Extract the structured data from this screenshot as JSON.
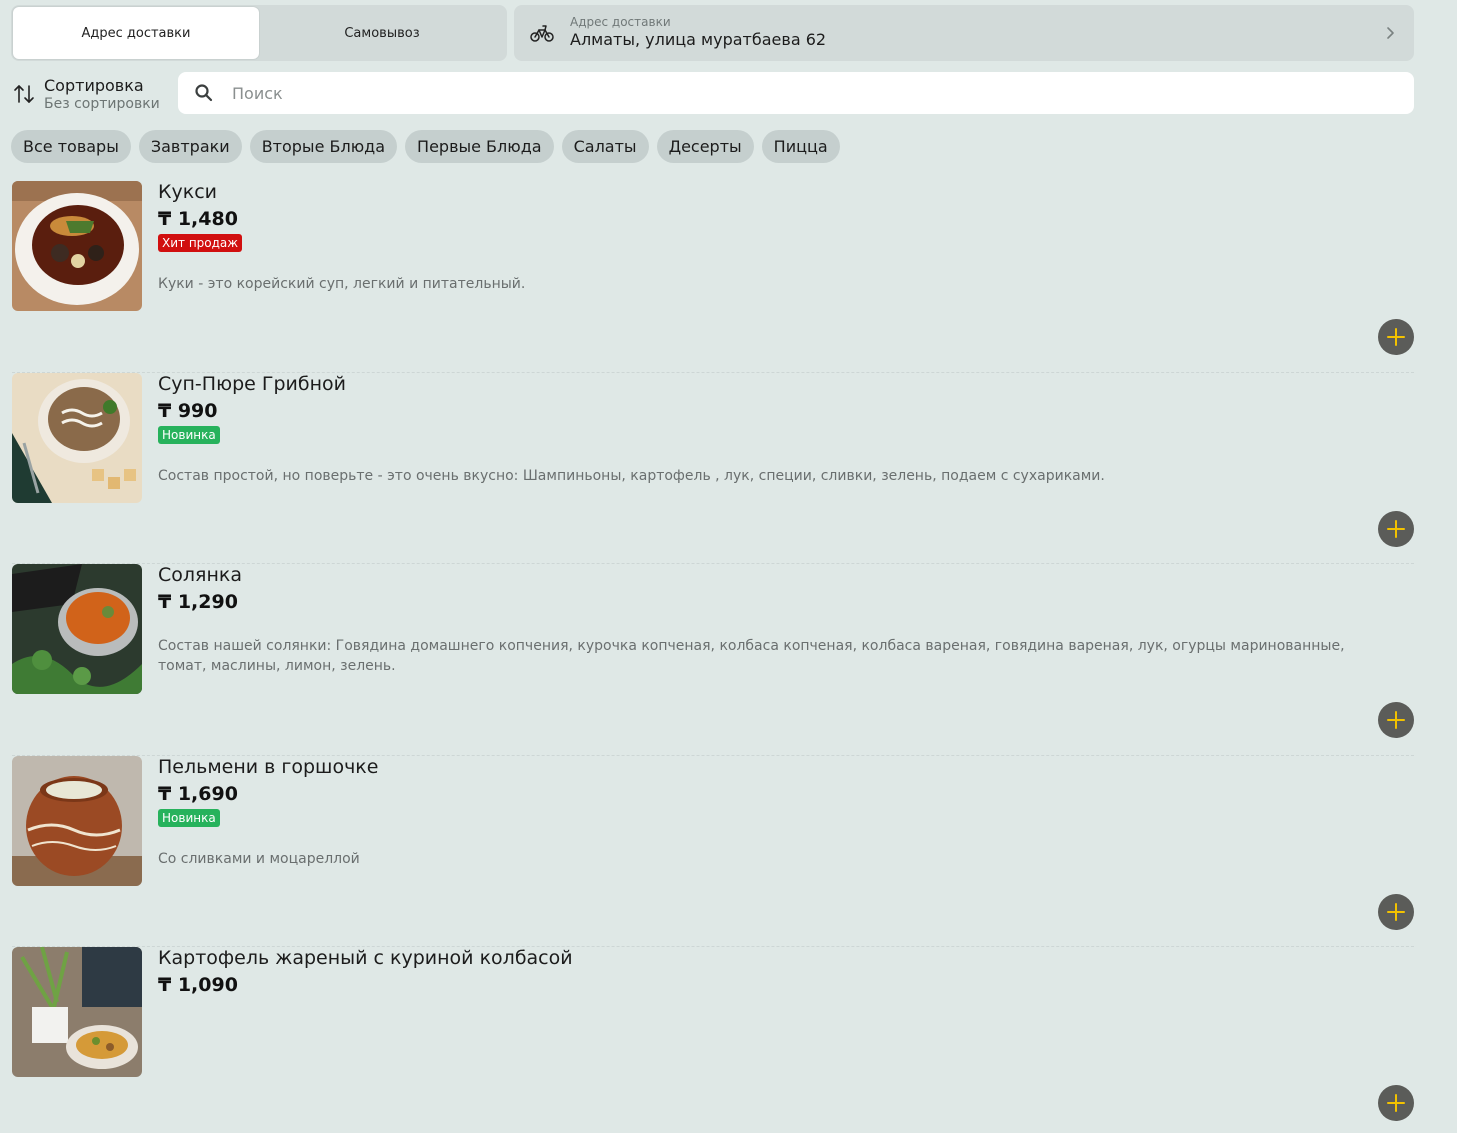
{
  "delivery_toggle": {
    "delivery_label": "Адрес доставки",
    "pickup_label": "Самовывоз"
  },
  "address": {
    "label": "Адрес доставки",
    "value": "Алматы, улица муратбаева 62"
  },
  "sort": {
    "title": "Сортировка",
    "subtitle": "Без сортировки"
  },
  "search": {
    "placeholder": "Поиск"
  },
  "categories": [
    "Все товары",
    "Завтраки",
    "Вторые Блюда",
    "Первые Блюда",
    "Салаты",
    "Десерты",
    "Пицца"
  ],
  "products": [
    {
      "name": "Кукси",
      "price": "₸ 1,480",
      "badge": "Хит продаж",
      "badge_color": "#d10f0f",
      "description": "Куки - это корейский суп, легкий и питательный."
    },
    {
      "name": "Суп-Пюре Грибной",
      "price": "₸ 990",
      "badge": "Новинка",
      "badge_color": "#27b25c",
      "description": "Состав простой, но поверьте - это очень вкусно: Шампиньоны, картофель , лук, специи, сливки, зелень, подаем с сухариками."
    },
    {
      "name": "Солянка",
      "price": "₸ 1,290",
      "badge": "",
      "badge_color": "",
      "description": "Состав нашей солянки: Говядина домашнего копчения, курочка копченая, колбаса копченая, колбаса вареная, говядина вареная, лук, огурцы маринованные, томат, маслины, лимон, зелень."
    },
    {
      "name": "Пельмени в горшочке",
      "price": "₸ 1,690",
      "badge": "Новинка",
      "badge_color": "#27b25c",
      "description": "Со сливками и моцареллой"
    },
    {
      "name": "Картофель жареный с куриной колбасой",
      "price": "₸ 1,090",
      "badge": "",
      "badge_color": "",
      "description": ""
    }
  ],
  "colors": {
    "background": "#dfe8e6",
    "add_button": "#5b5c59",
    "add_icon": "#f2c200"
  },
  "icons": {
    "delivery": "bicycle-icon",
    "chevron": "chevron-right-icon",
    "sort": "sort-arrows-icon",
    "search": "search-icon",
    "add": "plus-icon"
  }
}
